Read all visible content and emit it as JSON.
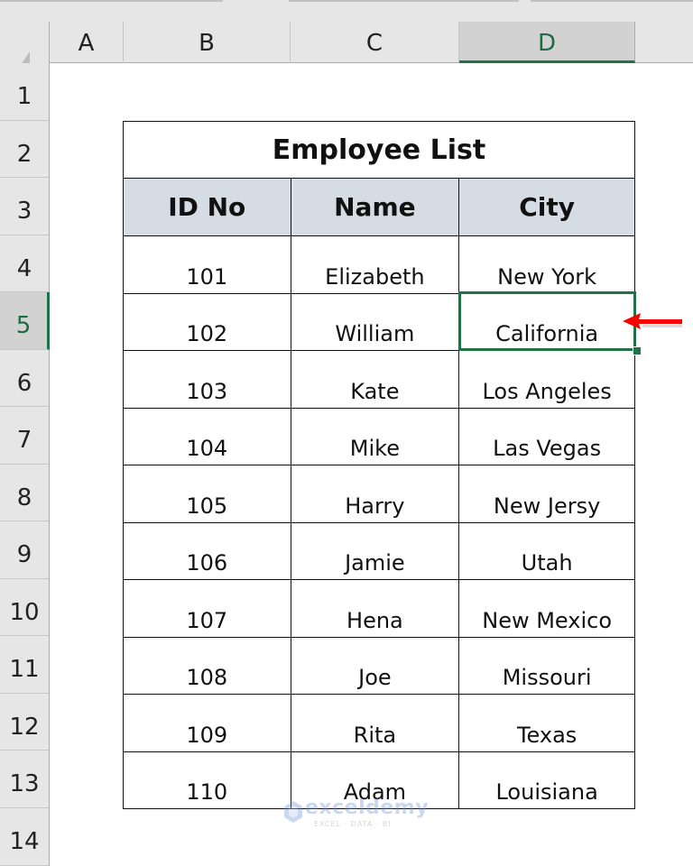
{
  "spreadsheet": {
    "columns": [
      "A",
      "B",
      "C",
      "D"
    ],
    "rows": [
      "1",
      "2",
      "3",
      "4",
      "5",
      "6",
      "7",
      "8",
      "9",
      "10",
      "11",
      "12",
      "13",
      "14"
    ],
    "selected_cell": "D5",
    "selected_column": "D",
    "selected_row": "5",
    "accent_color": "#217346"
  },
  "table": {
    "title": "Employee List",
    "headers": [
      "ID No",
      "Name",
      "City"
    ],
    "header_fill": "#d6dce4",
    "rows": [
      [
        "101",
        "Elizabeth",
        "New York"
      ],
      [
        "102",
        "William",
        "California"
      ],
      [
        "103",
        "Kate",
        "Los Angeles"
      ],
      [
        "104",
        "Mike",
        "Las Vegas"
      ],
      [
        "105",
        "Harry",
        "New Jersy"
      ],
      [
        "106",
        "Jamie",
        "Utah"
      ],
      [
        "107",
        "Hena",
        "New Mexico"
      ],
      [
        "108",
        "Joe",
        "Missouri"
      ],
      [
        "109",
        "Rita",
        "Texas"
      ],
      [
        "110",
        "Adam",
        "Louisiana"
      ]
    ]
  },
  "annotation": {
    "arrow_icon": "red-arrow-left",
    "arrow_color": "#ff0000"
  },
  "watermark": {
    "brand": "exceldemy",
    "tagline": "EXCEL · DATA · BI"
  }
}
